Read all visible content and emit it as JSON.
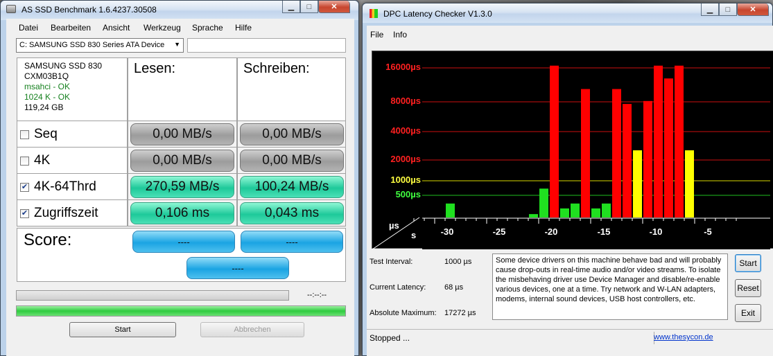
{
  "asssd": {
    "title": "AS SSD Benchmark 1.6.4237.30508",
    "menu": [
      "Datei",
      "Bearbeiten",
      "Ansicht",
      "Werkzeug",
      "Sprache",
      "Hilfe"
    ],
    "drive_select": "C: SAMSUNG SSD 830 Series ATA Device",
    "info": {
      "model": "SAMSUNG SSD 830",
      "firmware": "CXM03B1Q",
      "driver": "msahci - OK",
      "align": "1024 K - OK",
      "size": "119,24 GB"
    },
    "read_header": "Lesen:",
    "write_header": "Schreiben:",
    "rows": [
      {
        "label": "Seq",
        "checked": false,
        "read": "0,00 MB/s",
        "write": "0,00 MB/s",
        "state": "gray"
      },
      {
        "label": "4K",
        "checked": false,
        "read": "0,00 MB/s",
        "write": "0,00 MB/s",
        "state": "gray"
      },
      {
        "label": "4K-64Thrd",
        "checked": true,
        "read": "270,59 MB/s",
        "write": "100,24 MB/s",
        "state": "green"
      },
      {
        "label": "Zugriffszeit",
        "checked": true,
        "read": "0,106 ms",
        "write": "0,043 ms",
        "state": "green"
      }
    ],
    "score_label": "Score:",
    "score_read": "----",
    "score_write": "----",
    "score_total": "----",
    "time": "--:--:--",
    "progress": 1.0,
    "start_label": "Start",
    "abort_label": "Abbrechen",
    "colors": {
      "gray": "#a8a8a8",
      "green": "#2fd6a4",
      "blue": "#2aaee8",
      "progress": "#2fcc3f"
    }
  },
  "dpc": {
    "title": "DPC Latency Checker V1.3.0",
    "menu": [
      "File",
      "Info"
    ],
    "y_labels": [
      {
        "text": "16000µs",
        "color": "#ff2020"
      },
      {
        "text": "8000µs",
        "color": "#ff2020"
      },
      {
        "text": "4000µs",
        "color": "#ff2020"
      },
      {
        "text": "2000µs",
        "color": "#ff2020"
      },
      {
        "text": "1000µs",
        "color": "#ffff40"
      },
      {
        "text": "500µs",
        "color": "#40ff40"
      }
    ],
    "axis_unit_top": "µs",
    "axis_unit_bottom": "s",
    "x_ticks": [
      "-30",
      "-25",
      "-20",
      "-15",
      "-10",
      "-5"
    ],
    "stats": [
      {
        "label": "Test Interval:",
        "value": "1000 µs"
      },
      {
        "label": "Current Latency:",
        "value": "68 µs"
      },
      {
        "label": "Absolute Maximum:",
        "value": "17272 µs"
      }
    ],
    "message": "Some device drivers on this machine behave bad and will probably cause drop-outs in real-time audio and/or video streams. To isolate the misbehaving driver use Device Manager and disable/re-enable various devices, one at a time. Try network and W-LAN adapters, modems, internal sound devices, USB host controllers, etc.",
    "buttons": {
      "start": "Start",
      "reset": "Reset",
      "exit": "Exit"
    },
    "status": "Stopped ...",
    "link": "www.thesycon.de"
  },
  "chart_data": {
    "type": "bar",
    "title": "",
    "xlabel": "s",
    "ylabel": "µs",
    "y_scale": "log",
    "ylim": [
      0,
      16000
    ],
    "x": [
      -32,
      -31,
      -30,
      -29,
      -28,
      -27,
      -26,
      -25,
      -24,
      -23,
      -22,
      -21,
      -20,
      -19,
      -18,
      -17,
      -16,
      -15,
      -14,
      -13,
      -12,
      -11,
      -10,
      -9,
      -8,
      -7,
      -6,
      -5,
      -4,
      -3,
      -2,
      -1
    ],
    "values": [
      150,
      150,
      150,
      200,
      400,
      200,
      200,
      200,
      200,
      200,
      200,
      250,
      300,
      600,
      17000,
      350,
      400,
      9000,
      350,
      400,
      9000,
      6000,
      1700,
      6500,
      17000,
      12000,
      17000,
      1700,
      200,
      200,
      200,
      200
    ],
    "colors": [
      "#20e020",
      "#20e020",
      "#20e020",
      "#20e020",
      "#20e020",
      "#20e020",
      "#20e020",
      "#20e020",
      "#20e020",
      "#20e020",
      "#20e020",
      "#20e020",
      "#20e020",
      "#20e020",
      "#ff0000",
      "#20e020",
      "#20e020",
      "#ff0000",
      "#20e020",
      "#20e020",
      "#ff0000",
      "#ff0000",
      "#ffff00",
      "#ff0000",
      "#ff0000",
      "#ff0000",
      "#ff0000",
      "#ffff00",
      "#20e020",
      "#20e020",
      "#20e020",
      "#20e020"
    ],
    "grid": true
  }
}
